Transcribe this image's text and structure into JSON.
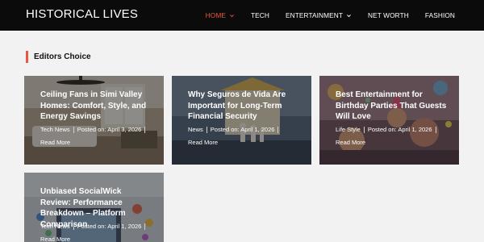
{
  "header": {
    "brand": "HISTORICAL LIVES",
    "nav": [
      {
        "label": "HOME",
        "dropdown": true,
        "active": true
      },
      {
        "label": "TECH",
        "dropdown": false,
        "active": false
      },
      {
        "label": "ENTERTAINMENT",
        "dropdown": true,
        "active": false
      },
      {
        "label": "NET WORTH",
        "dropdown": false,
        "active": false
      },
      {
        "label": "FASHION",
        "dropdown": false,
        "active": false
      }
    ]
  },
  "section": {
    "title": "Editors Choice"
  },
  "cards": [
    {
      "title": "Ceiling Fans in Simi Valley Homes: Comfort, Style, and Energy Savings",
      "category": "Tech News",
      "posted": "Posted on: April 3, 2026",
      "read_more": "Read More"
    },
    {
      "title": "Why Seguros de Vida Are Important for Long-Term Financial Security",
      "category": "News",
      "posted": "Posted on: April 1, 2026",
      "read_more": "Read More"
    },
    {
      "title": "Best Entertainment for Birthday Parties That Guests Will Love",
      "category": "Life Style",
      "posted": "Posted on: April 1, 2026",
      "read_more": "Read More"
    },
    {
      "title": "Unbiased SocialWick Review: Performance Breakdown – Platform Comparison",
      "category": "Tech News",
      "posted": "Posted on: April 1, 2026",
      "read_more": "Read More"
    }
  ],
  "colors": {
    "accent": "#e8573f",
    "header_bg": "#0b0b0b",
    "page_bg": "#f2f2f2"
  }
}
